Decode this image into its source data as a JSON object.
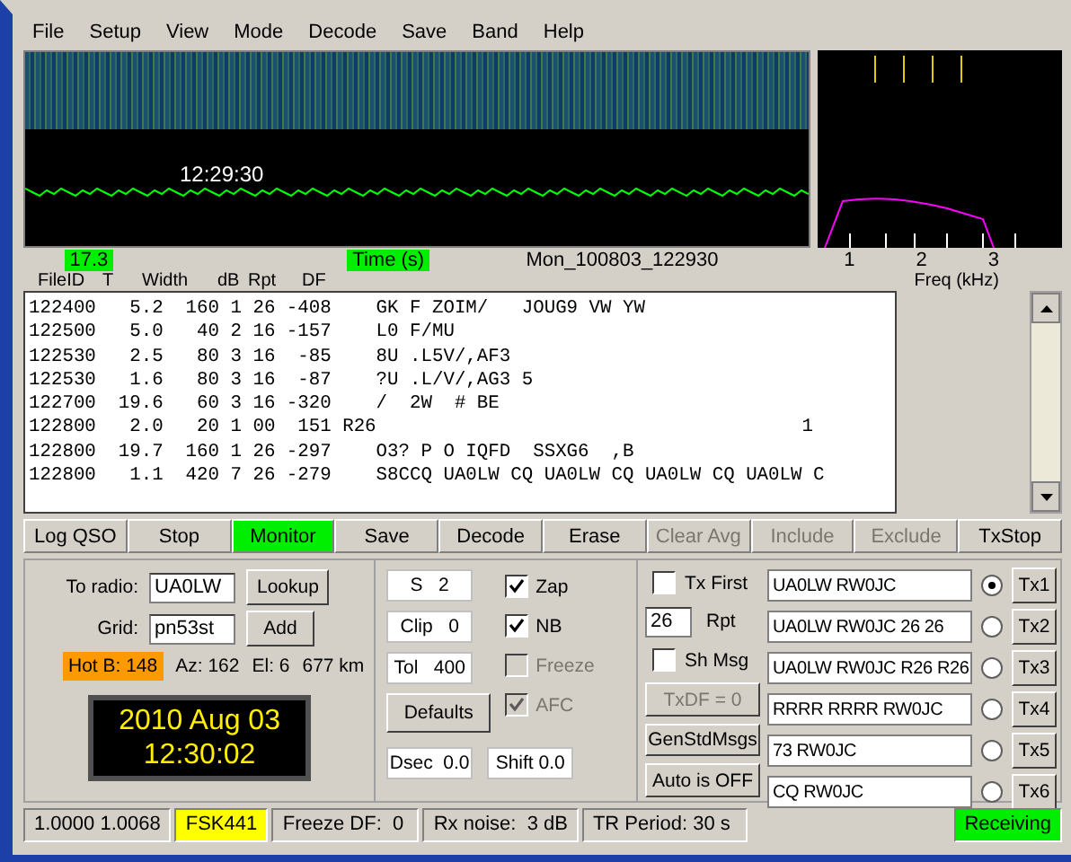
{
  "menu": [
    "File",
    "Setup",
    "View",
    "Mode",
    "Decode",
    "Save",
    "Band",
    "Help"
  ],
  "waterfall": {
    "time_label": "12:29:30"
  },
  "spectrum": {
    "freq_ticks": [
      "1",
      "2",
      "3"
    ],
    "freq_label": "Freq (kHz)"
  },
  "info_row": {
    "level": "17.3",
    "time_label": "Time (s)",
    "file_name": "Mon_100803_122930"
  },
  "decode_columns": [
    "FileID",
    "T",
    "Width",
    "dB",
    "Rpt",
    "DF"
  ],
  "decodes": [
    "122400   5.2  160 1 26 -408    GK F ZOIM/   JOUG9 VW YW",
    "122500   5.0   40 2 16 -157    L0 F/MU",
    "122530   2.5   80 3 16  -85    8U .L5V/,AF3",
    "122530   1.6   80 3 16  -87    ?U .L/V/,AG3 5",
    "122700  19.6   60 3 16 -320    /  2W  # BE",
    "122800   2.0   20 1 00  151 R26                                      1",
    "122800  19.7  160 1 26 -297    O3? P O IQFD  SSXG6  ,B",
    "122800   1.1  420 7 26 -279    S8CCQ UA0LW CQ UA0LW CQ UA0LW CQ UA0LW C"
  ],
  "buttons": [
    {
      "label": "Log QSO",
      "selected": false,
      "disabled": false
    },
    {
      "label": "Stop",
      "selected": false,
      "disabled": false
    },
    {
      "label": "Monitor",
      "selected": true,
      "disabled": false
    },
    {
      "label": "Save",
      "selected": false,
      "disabled": false
    },
    {
      "label": "Decode",
      "selected": false,
      "disabled": false
    },
    {
      "label": "Erase",
      "selected": false,
      "disabled": false
    },
    {
      "label": "Clear Avg",
      "selected": false,
      "disabled": true
    },
    {
      "label": "Include",
      "selected": false,
      "disabled": true
    },
    {
      "label": "Exclude",
      "selected": false,
      "disabled": true
    },
    {
      "label": "TxStop",
      "selected": false,
      "disabled": false
    }
  ],
  "station": {
    "to_radio_label": "To radio:",
    "to_radio": "UA0LW",
    "lookup": "Lookup",
    "grid_label": "Grid:",
    "grid": "pn53st",
    "add": "Add",
    "hot": "Hot B: 148",
    "az": "Az: 162",
    "el": "El: 6",
    "distance": "677 km",
    "date": "2010 Aug 03",
    "time": "12:30:02"
  },
  "settings": {
    "boxes": [
      {
        "label": "S",
        "value": "2"
      },
      {
        "label": "Clip",
        "value": "0"
      },
      {
        "label": "Tol",
        "value": "400"
      }
    ],
    "defaults": "Defaults",
    "checks": [
      {
        "label": "Zap",
        "checked": true,
        "disabled": false
      },
      {
        "label": "NB",
        "checked": true,
        "disabled": false
      },
      {
        "label": "Freeze",
        "checked": false,
        "disabled": true
      },
      {
        "label": "AFC",
        "checked": true,
        "disabled": true
      }
    ],
    "dsec": "Dsec  0.0",
    "shift": "Shift 0.0"
  },
  "tx": {
    "tx_first": {
      "label": "Tx First",
      "checked": false
    },
    "rpt_value": "26",
    "rpt_label": "Rpt",
    "sh_msg": {
      "label": "Sh Msg",
      "checked": false
    },
    "actions": [
      {
        "label": "TxDF = 0",
        "disabled": true
      },
      {
        "label": "GenStdMsgs",
        "disabled": false
      },
      {
        "label": "Auto is OFF",
        "disabled": false
      }
    ],
    "messages": [
      {
        "text": "UA0LW RW0JC",
        "selected": true,
        "button": "Tx1"
      },
      {
        "text": "UA0LW RW0JC 26 26",
        "selected": false,
        "button": "Tx2"
      },
      {
        "text": "UA0LW RW0JC R26 R26",
        "selected": false,
        "button": "Tx3"
      },
      {
        "text": "RRRR RRRR RW0JC",
        "selected": false,
        "button": "Tx4"
      },
      {
        "text": "73 RW0JC",
        "selected": false,
        "button": "Tx5"
      },
      {
        "text": "CQ RW0JC",
        "selected": false,
        "button": "Tx6"
      }
    ]
  },
  "status_bar": [
    {
      "text": "1.0000 1.0068",
      "color": "#d4d0c8"
    },
    {
      "text": "FSK441",
      "color": "#ffff00"
    },
    {
      "text": "Freeze DF:  0",
      "color": "#d4d0c8"
    },
    {
      "text": "Rx noise:  3 dB",
      "color": "#d4d0c8"
    },
    {
      "text": "TR Period: 30 s",
      "color": "#d4d0c8"
    },
    {
      "text": "Receiving",
      "color": "#00ee00"
    }
  ]
}
